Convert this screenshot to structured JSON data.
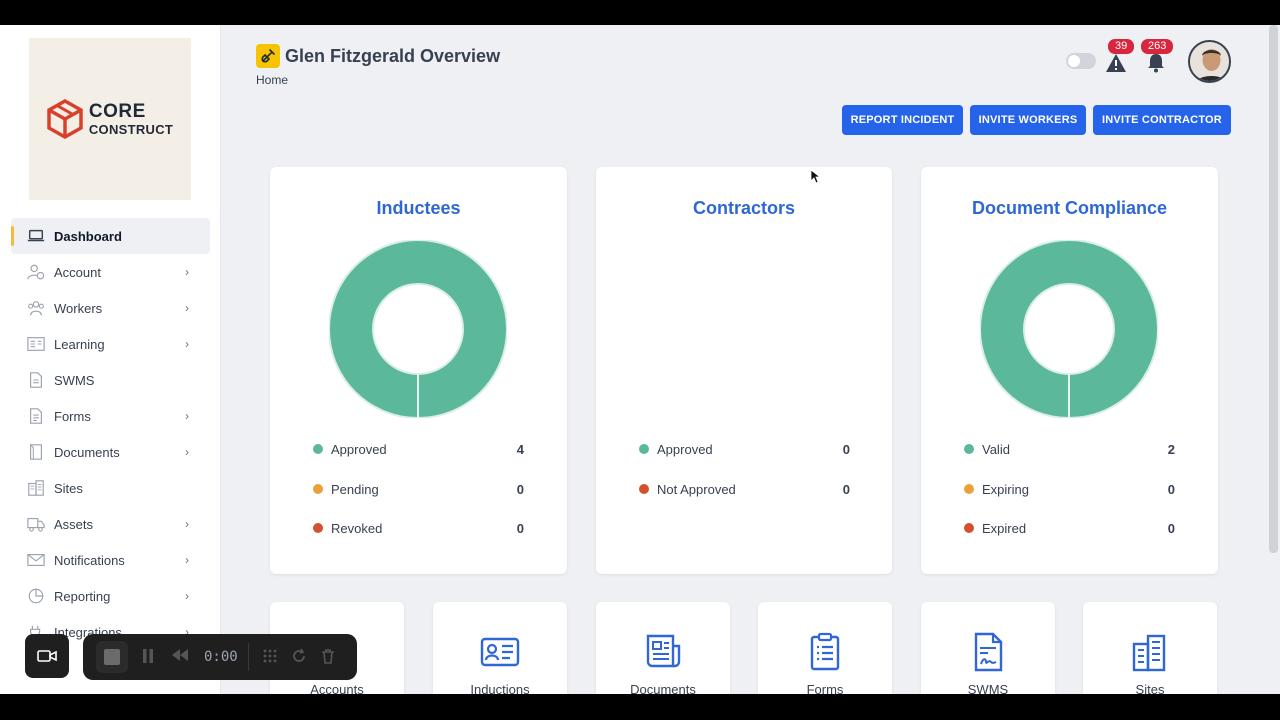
{
  "brand": {
    "line1": "CORE",
    "line2": "CONSTRUCT"
  },
  "sidebar": {
    "items": [
      {
        "label": "Dashboard",
        "icon": "laptop-icon",
        "chevron": false
      },
      {
        "label": "Account",
        "icon": "user-check-icon",
        "chevron": true
      },
      {
        "label": "Workers",
        "icon": "users-icon",
        "chevron": true
      },
      {
        "label": "Learning",
        "icon": "learning-icon",
        "chevron": true
      },
      {
        "label": "SWMS",
        "icon": "swms-doc-icon",
        "chevron": false
      },
      {
        "label": "Forms",
        "icon": "form-icon",
        "chevron": true
      },
      {
        "label": "Documents",
        "icon": "document-icon",
        "chevron": true
      },
      {
        "label": "Sites",
        "icon": "building-icon",
        "chevron": false
      },
      {
        "label": "Assets",
        "icon": "truck-icon",
        "chevron": true
      },
      {
        "label": "Notifications",
        "icon": "envelope-icon",
        "chevron": true
      },
      {
        "label": "Reporting",
        "icon": "pie-chart-icon",
        "chevron": true
      },
      {
        "label": "Integrations",
        "icon": "plug-icon",
        "chevron": true
      }
    ]
  },
  "header": {
    "title": "Glen Fitzgerald Overview",
    "breadcrumb": "Home",
    "alerts_count": "39",
    "notifications_count": "263"
  },
  "actions": {
    "report_incident": "REPORT INCIDENT",
    "invite_workers": "INVITE WORKERS",
    "invite_contractor": "INVITE CONTRACTOR"
  },
  "colors": {
    "green": "#5bb89a",
    "amber": "#e9a13b",
    "red": "#d4512d",
    "accent": "#2563eb",
    "title_blue": "#2f67d6"
  },
  "cards": [
    {
      "title": "Inductees",
      "legend": [
        {
          "label": "Approved",
          "value": 4
        },
        {
          "label": "Pending",
          "value": 0
        },
        {
          "label": "Revoked",
          "value": 0
        }
      ]
    },
    {
      "title": "Contractors",
      "legend": [
        {
          "label": "Approved",
          "value": 0
        },
        {
          "label": "Not Approved",
          "value": 0
        }
      ]
    },
    {
      "title": "Document Compliance",
      "legend": [
        {
          "label": "Valid",
          "value": 2
        },
        {
          "label": "Expiring",
          "value": 0
        },
        {
          "label": "Expired",
          "value": 0
        }
      ]
    }
  ],
  "tiles": [
    "Accounts",
    "Inductions",
    "Documents",
    "Forms",
    "SWMS",
    "Sites"
  ],
  "recorder": {
    "time": "0:00"
  }
}
